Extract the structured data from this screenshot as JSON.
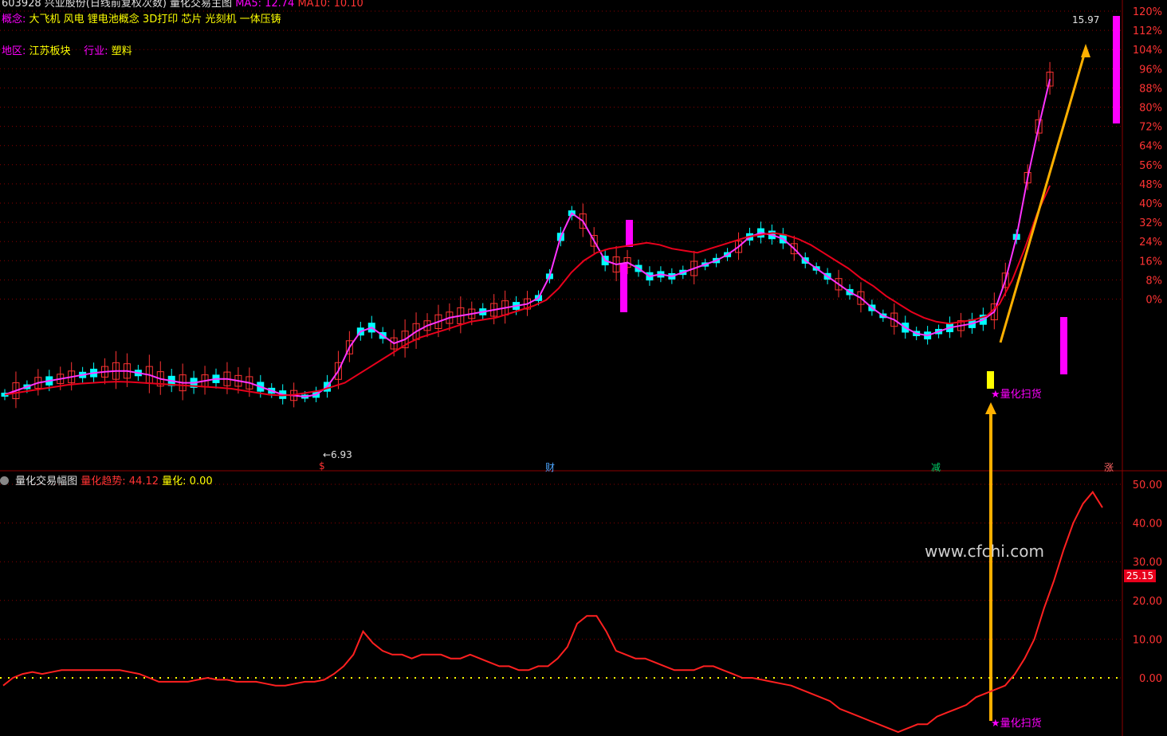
{
  "header": {
    "title_line": "603928 兴业股份(日线前复权次数)",
    "indicator_name": "量化交易主图",
    "ma5": "MA5: 12.74",
    "ma10": "MA10: 10.10"
  },
  "concept": {
    "label": "概念:",
    "items": "大飞机 风电 锂电池概念 3D打印 芯片 光刻机 一体压铸"
  },
  "region": {
    "label": "地区:",
    "value": "江苏板块",
    "industry_label": "行业:",
    "industry_value": "塑料"
  },
  "annotations": {
    "high_price": "15.97",
    "low_price": "←6.93",
    "signal_main": "★量化扫货",
    "signal_sub": "★量化扫货",
    "markers": [
      "$",
      "财",
      "减",
      "涨"
    ]
  },
  "sub_panel": {
    "name": "量化交易幅图",
    "trend_label": "量化趋势: 44.12",
    "quant_label": "量化: 0.00",
    "current_value": "25.15"
  },
  "watermark": "www.cfchi.com",
  "colors": {
    "up": "#ff3333",
    "down": "#00ffff",
    "ma_fast": "#ff33ff",
    "ma_slow": "#e8001c",
    "arrow": "#ffb000",
    "grid": "#8b0000"
  },
  "chart_data": [
    {
      "type": "candlestick",
      "title": "量化交易主图",
      "y_axis_right_percent": [
        "120%",
        "112%",
        "104%",
        "96%",
        "88%",
        "80%",
        "72%",
        "64%",
        "56%",
        "48%",
        "40%",
        "32%",
        "24%",
        "16%",
        "8%",
        "0%"
      ],
      "ylim": [
        6.0,
        16.5
      ],
      "series": [
        {
          "name": "MA5",
          "values": [
            7.0,
            7.1,
            7.2,
            7.3,
            7.35,
            7.4,
            7.45,
            7.5,
            7.55,
            7.58,
            7.6,
            7.6,
            7.55,
            7.5,
            7.4,
            7.35,
            7.3,
            7.3,
            7.35,
            7.4,
            7.4,
            7.35,
            7.3,
            7.2,
            7.1,
            7.0,
            6.98,
            6.95,
            7.0,
            7.2,
            7.6,
            8.2,
            8.6,
            8.7,
            8.5,
            8.3,
            8.4,
            8.6,
            8.75,
            8.85,
            8.95,
            9.0,
            9.05,
            9.1,
            9.15,
            9.2,
            9.25,
            9.3,
            9.45,
            10.0,
            11.0,
            11.6,
            11.4,
            10.9,
            10.4,
            10.3,
            10.35,
            10.2,
            10.0,
            10.05,
            10.0,
            10.1,
            10.2,
            10.3,
            10.4,
            10.55,
            10.75,
            11.0,
            11.1,
            11.05,
            10.95,
            10.7,
            10.4,
            10.2,
            10.0,
            9.8,
            9.6,
            9.45,
            9.2,
            9.0,
            8.9,
            8.7,
            8.55,
            8.5,
            8.6,
            8.7,
            8.75,
            8.8,
            8.9,
            9.1,
            9.9,
            11.0,
            12.5,
            13.8,
            15.0
          ]
        },
        {
          "name": "MA10",
          "values": [
            7.0,
            7.05,
            7.1,
            7.15,
            7.2,
            7.25,
            7.28,
            7.3,
            7.32,
            7.33,
            7.32,
            7.3,
            7.28,
            7.26,
            7.24,
            7.22,
            7.2,
            7.18,
            7.15,
            7.1,
            7.05,
            7.0,
            6.98,
            7.0,
            7.05,
            7.1,
            7.2,
            7.3,
            7.5,
            7.7,
            7.9,
            8.1,
            8.3,
            8.45,
            8.55,
            8.65,
            8.75,
            8.85,
            8.9,
            8.95,
            9.05,
            9.15,
            9.25,
            9.4,
            9.7,
            10.1,
            10.4,
            10.6,
            10.7,
            10.75,
            10.8,
            10.85,
            10.8,
            10.7,
            10.65,
            10.6,
            10.7,
            10.8,
            10.9,
            11.0,
            11.05,
            11.1,
            11.05,
            10.95,
            10.8,
            10.6,
            10.4,
            10.2,
            9.95,
            9.75,
            9.5,
            9.3,
            9.1,
            8.95,
            8.85,
            8.8,
            8.85,
            8.9,
            9.0,
            9.3,
            9.9,
            10.7,
            11.6,
            12.3
          ]
        }
      ],
      "markers_x": [
        "$",
        "财",
        "减",
        "涨"
      ]
    },
    {
      "type": "line",
      "title": "量化交易幅图",
      "y_axis": [
        "50.00",
        "40.00",
        "30.00",
        "20.00",
        "10.00",
        "0.00"
      ],
      "ylim": [
        -14,
        52
      ],
      "series": [
        {
          "name": "量化趋势",
          "values": [
            -2,
            0,
            1,
            1.5,
            1,
            1.5,
            2,
            2,
            2,
            2,
            2,
            2,
            2,
            1.5,
            1,
            0,
            -1,
            -1,
            -1,
            -1,
            -0.5,
            0,
            -0.5,
            -0.5,
            -1,
            -1,
            -1,
            -1.5,
            -2,
            -2,
            -1.5,
            -1,
            -1,
            -0.5,
            1,
            3,
            6,
            12,
            9,
            7,
            6,
            6,
            5,
            6,
            6,
            6,
            5,
            5,
            6,
            5,
            4,
            3,
            3,
            2,
            2,
            3,
            3,
            5,
            8,
            14,
            16,
            16,
            12,
            7,
            6,
            5,
            5,
            4,
            3,
            2,
            2,
            2,
            3,
            3,
            2,
            1,
            0,
            0,
            -0.5,
            -1,
            -1.5,
            -2,
            -3,
            -4,
            -5,
            -6,
            -8,
            -9,
            -10,
            -11,
            -12,
            -13,
            -14,
            -13,
            -12,
            -12,
            -10,
            -9,
            -8,
            -7,
            -5,
            -4,
            -3,
            -2,
            1,
            5,
            10,
            18,
            25,
            33,
            40,
            45,
            48,
            44
          ]
        },
        {
          "name": "量化",
          "values": [
            0
          ]
        }
      ],
      "current_value": 25.15
    }
  ]
}
